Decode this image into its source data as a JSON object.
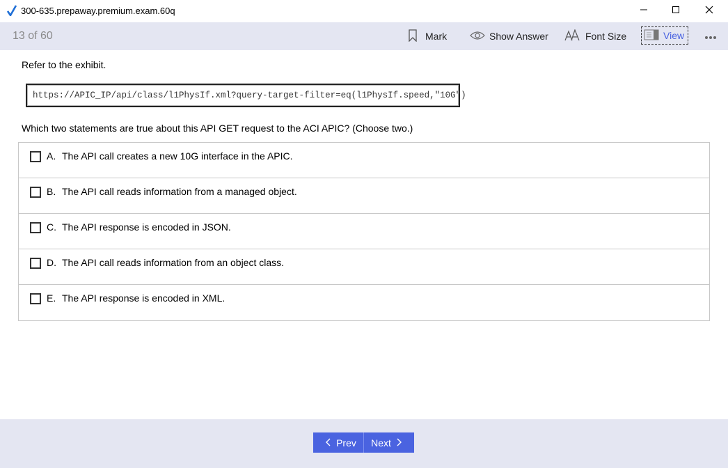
{
  "window": {
    "title": "300-635.prepaway.premium.exam.60q"
  },
  "toolbar": {
    "counter": "13 of 60",
    "mark_label": "Mark",
    "show_answer_label": "Show Answer",
    "font_size_label": "Font Size",
    "view_label": "View"
  },
  "question": {
    "intro": "Refer to the exhibit.",
    "exhibit": "https://APIC_IP/api/class/l1PhysIf.xml?query-target-filter=eq(l1PhysIf.speed,\"10G\")",
    "text": "Which two statements are true about this API GET request to the ACI APIC? (Choose two.)",
    "options": [
      {
        "letter": "A.",
        "text": "The API call creates a new 10G interface in the APIC."
      },
      {
        "letter": "B.",
        "text": "The API call reads information from a managed object."
      },
      {
        "letter": "C.",
        "text": "The API response is encoded in JSON."
      },
      {
        "letter": "D.",
        "text": "The API call reads information from an object class."
      },
      {
        "letter": "E.",
        "text": "The API response is encoded in XML."
      }
    ]
  },
  "footer": {
    "prev_label": "Prev",
    "next_label": "Next"
  },
  "colors": {
    "accent": "#4a63e0",
    "toolbar_bg": "#e4e6f2",
    "checkmark": "#1f6fd6"
  },
  "icons": [
    "checkmark-logo-icon",
    "minimize-icon",
    "maximize-icon",
    "close-icon",
    "bookmark-icon",
    "eye-icon",
    "font-size-icon",
    "view-icon",
    "more-icon",
    "chevron-left-icon",
    "chevron-right-icon"
  ]
}
